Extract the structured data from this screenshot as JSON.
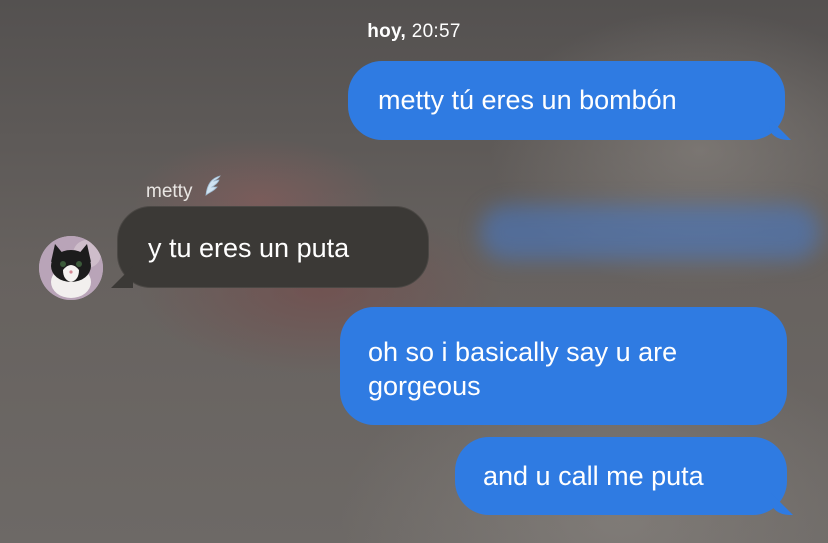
{
  "header": {
    "timestamp_day": "hoy,",
    "timestamp_time": "20:57"
  },
  "messages": [
    {
      "text": "metty tú eres un bombón"
    },
    {
      "sender": "metty",
      "text": "y tu eres un puta"
    },
    {
      "text": "oh so i basically say u are gorgeous"
    },
    {
      "text": "and u call me puta"
    }
  ],
  "colors": {
    "sent_bubble": "#2f7be2",
    "received_bubble": "#3b3936"
  },
  "icons": {
    "sender_badge": "wing-icon",
    "avatar": "cat-avatar"
  }
}
